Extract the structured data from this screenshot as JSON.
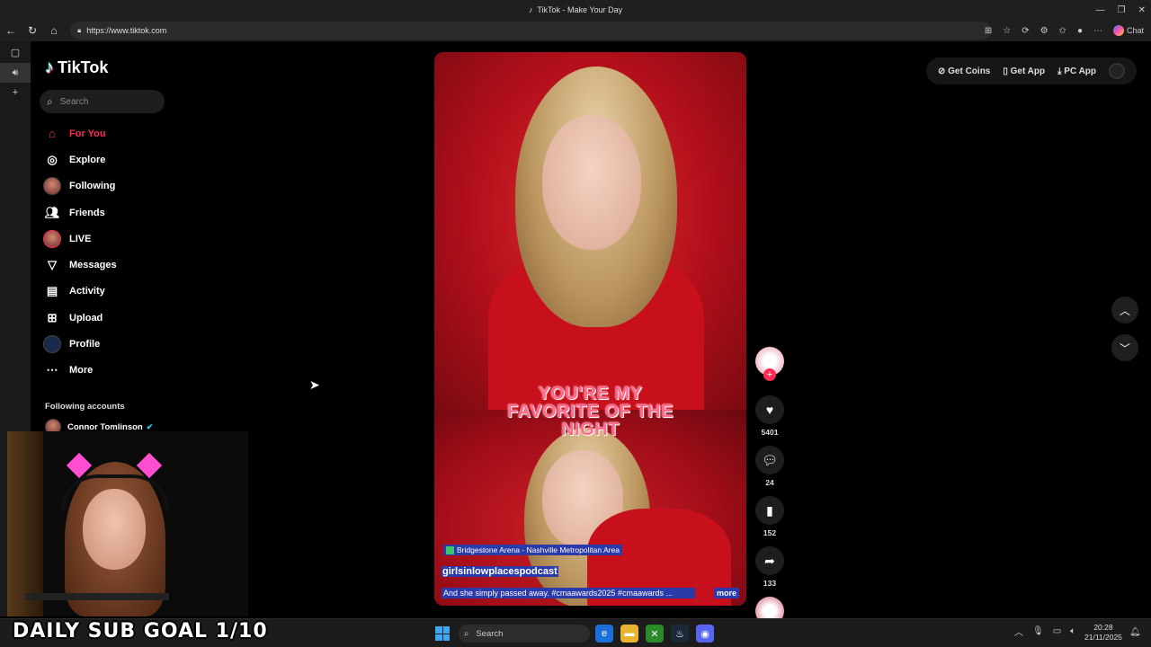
{
  "window": {
    "title": "TikTok - Make Your Day",
    "controls": [
      "—",
      "❐",
      "✕"
    ]
  },
  "browser": {
    "url": "https://www.tiktok.com",
    "chat_label": "Chat"
  },
  "sidebar": {
    "logo": "TikTok",
    "search_placeholder": "Search",
    "items": [
      {
        "label": "For You",
        "icon": "home-icon"
      },
      {
        "label": "Explore",
        "icon": "compass-icon"
      },
      {
        "label": "Following",
        "icon": "avatar"
      },
      {
        "label": "Friends",
        "icon": "friends-icon"
      },
      {
        "label": "LIVE",
        "icon": "avatar"
      },
      {
        "label": "Messages",
        "icon": "send-icon"
      },
      {
        "label": "Activity",
        "icon": "activity-icon"
      },
      {
        "label": "Upload",
        "icon": "upload-icon"
      },
      {
        "label": "Profile",
        "icon": "profile-icon"
      },
      {
        "label": "More",
        "icon": "more-icon"
      }
    ],
    "following_header": "Following accounts",
    "following_accounts": [
      {
        "name": "Connor Tomlinson"
      }
    ]
  },
  "top_actions": {
    "get_coins": "Get Coins",
    "get_app": "Get App",
    "pc_app": "PC App"
  },
  "video": {
    "overlay_text_lines": [
      "YOU'RE MY",
      "FAVORITE OF THE",
      "NIGHT"
    ],
    "location": "Bridgestone Arena - Nashville Metropolitan Area",
    "author": "girlsinlowplacespodcast",
    "caption": "And she simply passed away. #cmaawards2025 #cmaawards ...",
    "more_label": "more",
    "likes": "5401",
    "comments": "24",
    "saves": "152",
    "shares": "133"
  },
  "stream_overlay": {
    "sub_goal": "DAILY SUB GOAL 1/10"
  },
  "taskbar": {
    "search_placeholder": "Search",
    "time": "20:28",
    "date": "21/11/2025"
  },
  "colors": {
    "accent": "#fe2c55",
    "caption_highlight": "#2a3aa8",
    "video_red": "#b10f1a"
  }
}
